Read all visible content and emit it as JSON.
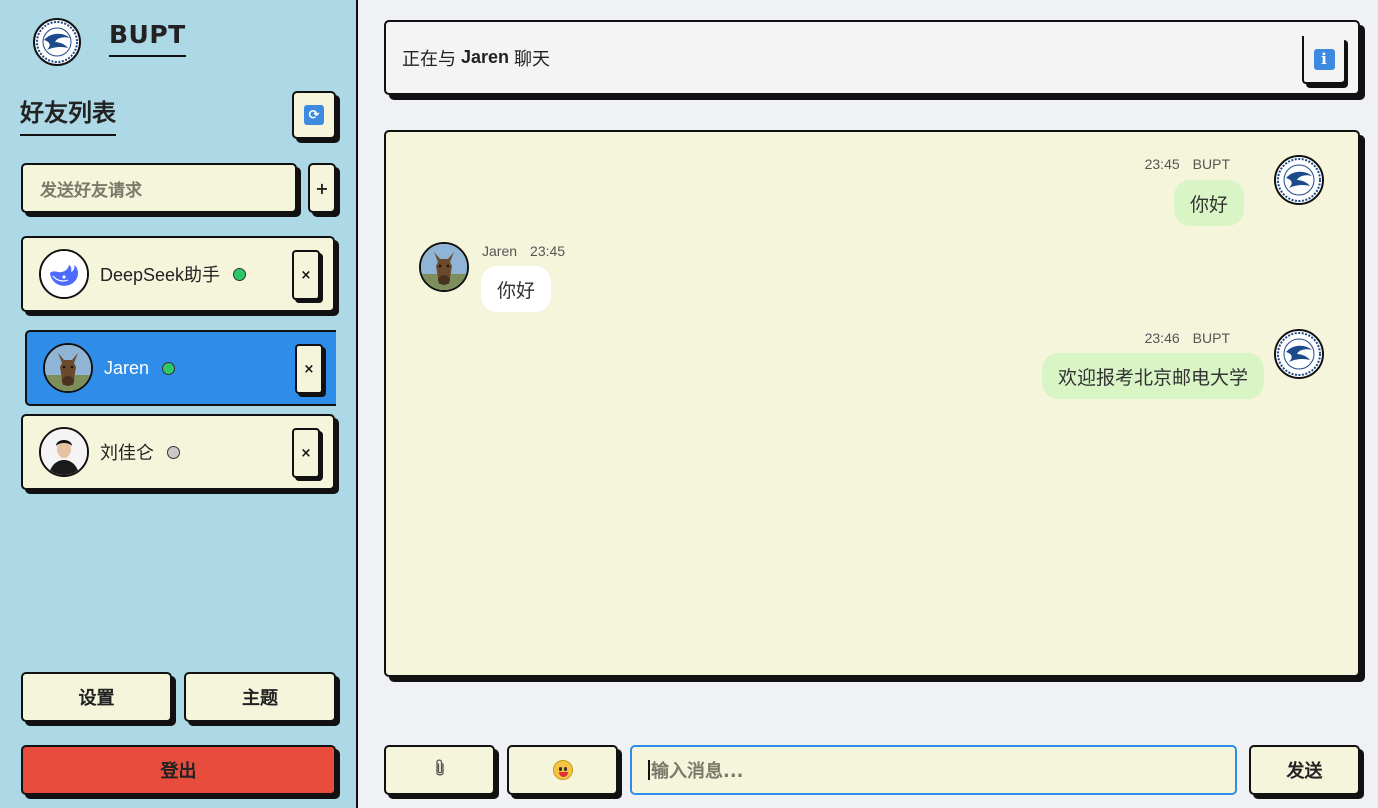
{
  "sidebar": {
    "app_name": "BUPT",
    "friends_title": "好友列表",
    "friend_request_placeholder": "发送好友请求",
    "add_label": "+",
    "friends": [
      {
        "name": "DeepSeek助手",
        "status": "online",
        "remove_label": "×"
      },
      {
        "name": "Jaren",
        "status": "online",
        "remove_label": "×",
        "active": true
      },
      {
        "name": "刘佳仑",
        "status": "offline",
        "remove_label": "×"
      }
    ],
    "settings_label": "设置",
    "theme_label": "主题",
    "logout_label": "登出"
  },
  "header": {
    "prefix": "正在与",
    "contact": "Jaren",
    "suffix": "聊天",
    "info_icon": "info-icon"
  },
  "messages": [
    {
      "sender": "BUPT",
      "time": "23:45",
      "text": "你好",
      "self": true
    },
    {
      "sender": "Jaren",
      "time": "23:45",
      "text": "你好",
      "self": false
    },
    {
      "sender": "BUPT",
      "time": "23:46",
      "text": "欢迎报考北京邮电大学",
      "self": true
    }
  ],
  "composer": {
    "attach_icon": "paperclip-icon",
    "emoji_icon": "emoji-icon",
    "placeholder": "输入消息...",
    "send_label": "发送"
  },
  "colors": {
    "sidebar_bg": "#add8e6",
    "card_bg": "#f5f5dc",
    "active_friend": "#2e8de8",
    "logout": "#e74c3c",
    "self_bubble": "#d9f5c6",
    "online": "#2ec866"
  }
}
